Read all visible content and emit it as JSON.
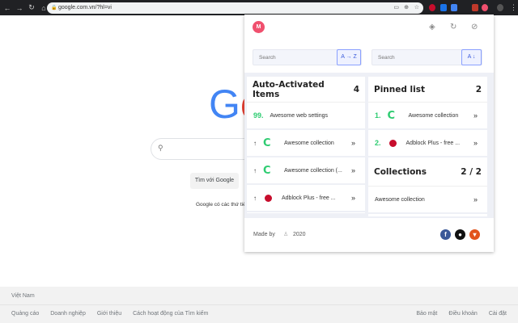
{
  "browser": {
    "url": "google.com.vn/?hl=vi"
  },
  "google": {
    "logo": "Go",
    "search_button": "Tìm với Google",
    "offered_in": "Google có các thứ tiếng"
  },
  "footer": {
    "country": "Việt Nam",
    "links": [
      "Quảng cáo",
      "Doanh nghiệp",
      "Giới thiệu",
      "Cách hoạt động của Tìm kiếm"
    ],
    "right_links": [
      "Bảo mật",
      "Điều khoản",
      "Cài đặt"
    ]
  },
  "popup": {
    "avatar": "M",
    "search_left": {
      "placeholder": "Search",
      "sort": "A → Z"
    },
    "search_right": {
      "placeholder": "Search",
      "sort": "A ↓"
    },
    "auto": {
      "title": "Auto-Activated Items",
      "count": "4",
      "items": [
        {
          "prefix": "99.",
          "label": "Awesome web settings"
        },
        {
          "prefix": "↑",
          "label": "Awesome collection"
        },
        {
          "prefix": "↑",
          "label": "Awesome collection (..."
        },
        {
          "prefix": "↑",
          "label": "Adblock Plus - free ..."
        }
      ]
    },
    "pinned": {
      "title": "Pinned list",
      "count": "2",
      "items": [
        {
          "prefix": "1.",
          "label": "Awesome collection"
        },
        {
          "prefix": "2.",
          "label": "Adblock Plus - free ..."
        }
      ]
    },
    "collections": {
      "title": "Collections",
      "count": "2 / 2",
      "items": [
        {
          "label": "Awesome collection"
        }
      ]
    },
    "footer": {
      "made_by": "Made by",
      "year": "2020"
    }
  }
}
